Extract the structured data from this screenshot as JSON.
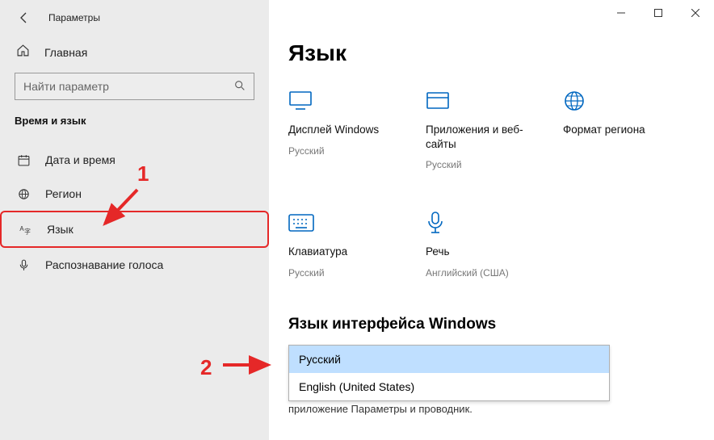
{
  "window": {
    "title": "Параметры"
  },
  "sidebar": {
    "home": "Главная",
    "search_placeholder": "Найти параметр",
    "section": "Время и язык",
    "items": [
      {
        "label": "Дата и время"
      },
      {
        "label": "Регион"
      },
      {
        "label": "Язык"
      },
      {
        "label": "Распознавание голоса"
      }
    ]
  },
  "page": {
    "h1": "Язык",
    "tiles": [
      {
        "title": "Дисплей Windows",
        "sub": "Русский"
      },
      {
        "title": "Приложения и веб-сайты",
        "sub": "Русский"
      },
      {
        "title": "Формат региона",
        "sub": ""
      },
      {
        "title": "Клавиатура",
        "sub": "Русский"
      },
      {
        "title": "Речь",
        "sub": "Английский (США)"
      }
    ],
    "h2": "Язык интерфейса Windows",
    "dropdown": {
      "options": [
        {
          "label": "Русский"
        },
        {
          "label": "English (United States)"
        }
      ]
    },
    "under_text": "приложение  Параметры  и проводник."
  },
  "annot": {
    "n1": "1",
    "n2": "2"
  }
}
